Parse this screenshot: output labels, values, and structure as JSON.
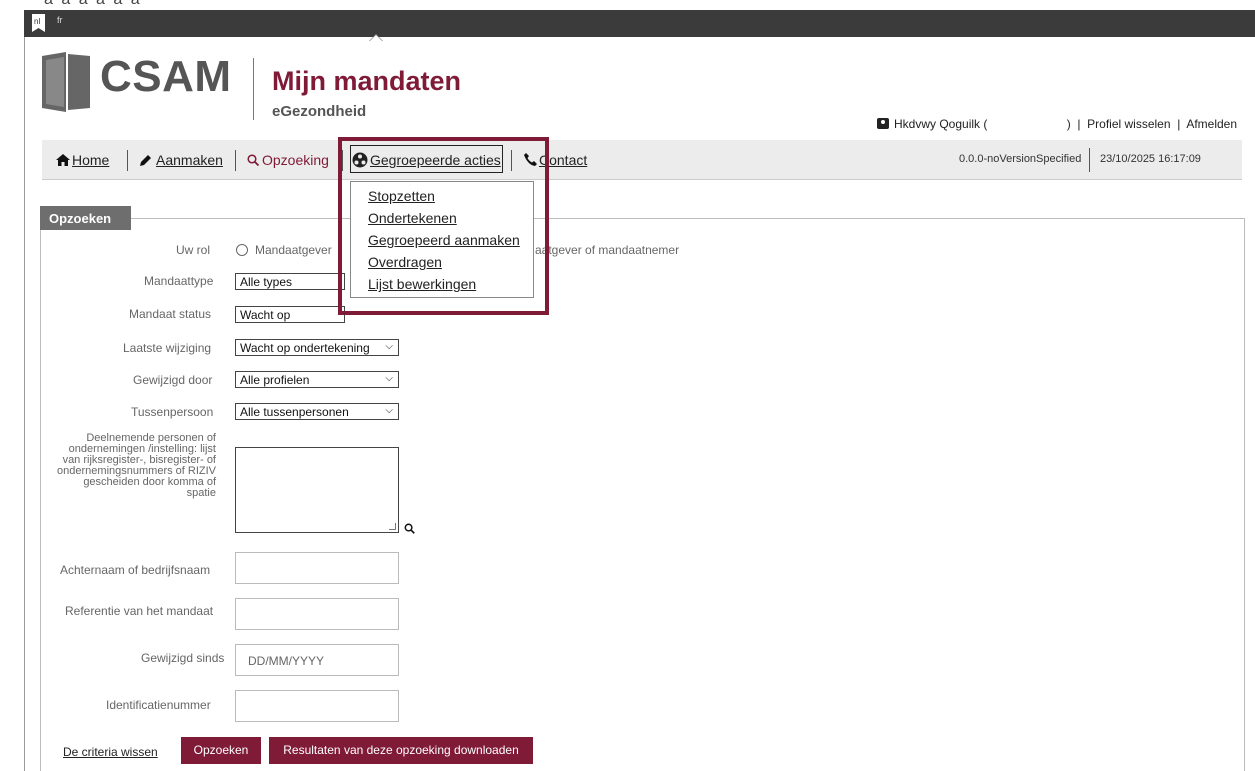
{
  "language": {
    "active": "nl",
    "other": "fr"
  },
  "header": {
    "logo_text": "CSAM",
    "app_title": "Mijn mandaten",
    "app_subtitle": "eGezondheid",
    "user_name": "Hkdvwy Qoguilk (",
    "user_rest": ")",
    "switch_profile": "Profiel wisselen",
    "logout": "Afmelden"
  },
  "nav": {
    "home": "Home",
    "create": "Aanmaken",
    "search": "Opzoeking",
    "grouped": "Gegroepeerde acties",
    "contact": "Contact",
    "version": "0.0.0-noVersionSpecified",
    "datetime": "23/10/2025 16:17:09"
  },
  "grouped_menu": [
    "Stopzetten",
    "Ondertekenen",
    "Gegroepeerd aanmaken",
    "Overdragen",
    "Lijst bewerkingen"
  ],
  "form": {
    "tab_title": "Opzoeken",
    "role_label": "Uw rol",
    "role_option1": "Mandaatgever",
    "role_option3_tail": "aatgever of mandaatnemer",
    "type_label": "Mandaattype",
    "type_value": "Alle types",
    "status_label": "Mandaat status",
    "status_value": "Wacht op",
    "lastchange_label": "Laatste wijziging",
    "lastchange_value": "Wacht op ondertekening",
    "changedby_label": "Gewijzigd door",
    "changedby_value": "Alle profielen",
    "intermediary_label": "Tussenpersoon",
    "intermediary_value": "Alle tussenpersonen",
    "participants_label": "Deelnemende personen of ondernemingen /instelling: lijst van rijksregister-, bisregister- of ondernemingsnummers of RIZIV gescheiden door komma of spatie",
    "lastname_label": "Achternaam of bedrijfsnaam",
    "reference_label": "Referentie van het mandaat",
    "since_label": "Gewijzigd sinds",
    "since_placeholder": "DD/MM/YYYY",
    "idnumber_label": "Identificatienummer"
  },
  "actions": {
    "clear": "De criteria wissen",
    "search": "Opzoeken",
    "download": "Resultaten van deze opzoeking downloaden"
  },
  "colors": {
    "brand": "#7f1a37",
    "langbar": "#3b3b3b",
    "navbar": "#ececec"
  }
}
